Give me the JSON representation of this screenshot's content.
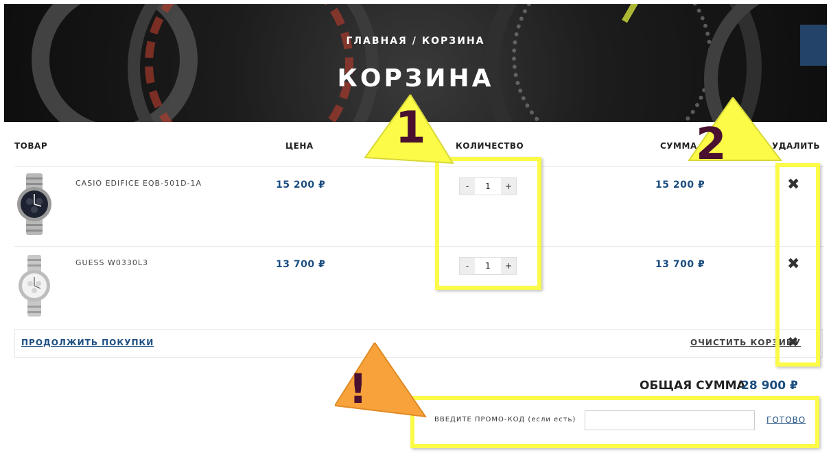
{
  "header": {
    "breadcrumb": "ГЛАВНАЯ  / КОРЗИНА",
    "title": "КОРЗИНА"
  },
  "table": {
    "columns": {
      "product": "ТОВАР",
      "price": "ЦЕНА",
      "quantity": "КОЛИЧЕСТВО",
      "sum": "СУММА",
      "delete": "УДАЛИТЬ"
    },
    "rows": [
      {
        "name": "CASIO EDIFICE EQB-501D-1A",
        "price": "15 200 ₽",
        "quantity": "1",
        "sum": "15 200 ₽",
        "minus": "-",
        "plus": "+",
        "remove": "✖"
      },
      {
        "name": "GUESS W0330L3",
        "price": "13 700 ₽",
        "quantity": "1",
        "sum": "13 700 ₽",
        "minus": "-",
        "plus": "+",
        "remove": "✖"
      }
    ]
  },
  "actions": {
    "continue": "ПРОДОЛЖИТЬ ПОКУПКИ",
    "clear": "ОЧИСТИТЬ КОРЗИНУ",
    "clear_icon": "✖"
  },
  "total": {
    "label": "ОБЩАЯ СУММА",
    "value": "28 900 ₽"
  },
  "promo": {
    "label": "ВВЕДИТЕ ПРОМО-КОД (если есть)",
    "input_value": "",
    "submit": "ГОТОВО"
  },
  "annotations": {
    "callout_1": "1",
    "callout_2": "2",
    "callout_warning": "!",
    "highlight_color": "#fbfb48",
    "warning_color": "#f7a23b"
  }
}
